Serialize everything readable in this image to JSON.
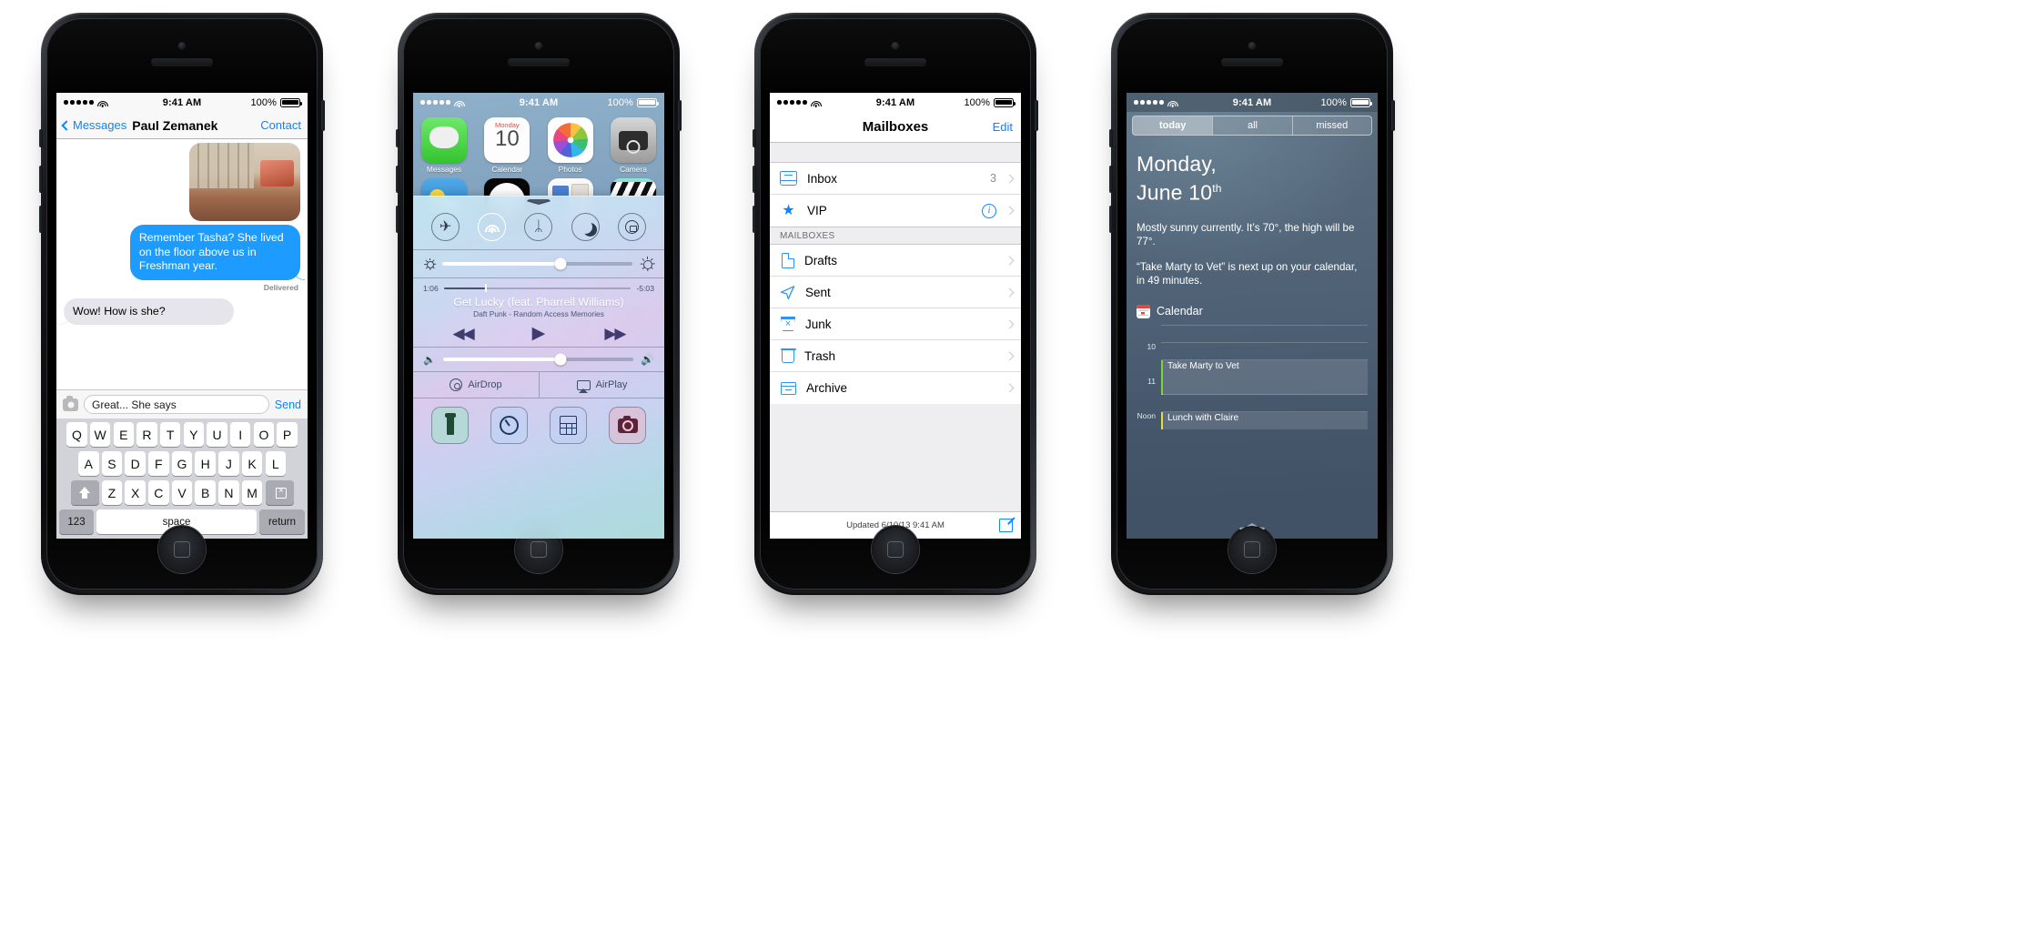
{
  "phones": {
    "messages": {
      "status": {
        "time": "9:41 AM",
        "battery": "100%",
        "signal_dots": 5
      },
      "nav": {
        "back_label": "Messages",
        "title": "Paul Zemanek",
        "right_label": "Contact"
      },
      "thread": {
        "outgoing_message": "Remember Tasha? She lived on the floor above us in Freshman year.",
        "delivered_label": "Delivered",
        "incoming_message": "Wow! How is she?"
      },
      "composer": {
        "camera_icon": "camera-icon",
        "input_value": "Great... She says",
        "send_label": "Send"
      },
      "keyboard": {
        "row1": [
          "Q",
          "W",
          "E",
          "R",
          "T",
          "Y",
          "U",
          "I",
          "O",
          "P"
        ],
        "row2": [
          "A",
          "S",
          "D",
          "F",
          "G",
          "H",
          "J",
          "K",
          "L"
        ],
        "row3": [
          "Z",
          "X",
          "C",
          "V",
          "B",
          "N",
          "M"
        ],
        "shift_icon": "shift-icon",
        "delete_icon": "delete-icon",
        "numbers_key": "123",
        "space_key": "space",
        "return_key": "return"
      }
    },
    "control_center": {
      "status": {
        "time": "9:41 AM",
        "battery": "100%",
        "signal_dots": 5
      },
      "apps_row1": [
        {
          "label": "Messages",
          "icon": "messages-app-icon"
        },
        {
          "label": "Calendar",
          "icon": "calendar-app-icon",
          "weekday": "Monday",
          "day": "10"
        },
        {
          "label": "Photos",
          "icon": "photos-app-icon"
        },
        {
          "label": "Camera",
          "icon": "camera-app-icon"
        }
      ],
      "apps_row2": [
        {
          "label": "",
          "icon": "weather-app-icon"
        },
        {
          "label": "",
          "icon": "clock-app-icon"
        },
        {
          "label": "",
          "icon": "newsstand-app-icon"
        },
        {
          "label": "",
          "icon": "videos-app-icon"
        }
      ],
      "toggles": [
        {
          "name": "airplane-mode-toggle",
          "glyph": "✈",
          "on": false
        },
        {
          "name": "wifi-toggle",
          "glyph": "wifi-icon",
          "on": true
        },
        {
          "name": "bluetooth-toggle",
          "glyph": "ᛦ",
          "on": false
        },
        {
          "name": "do-not-disturb-toggle",
          "glyph": "moon-icon",
          "on": false
        },
        {
          "name": "rotation-lock-toggle",
          "glyph": "lock-icon",
          "on": false
        }
      ],
      "brightness": {
        "value_percent": 62
      },
      "music": {
        "elapsed": "1:06",
        "remaining": "-5:03",
        "progress_percent": 22,
        "track": "Get Lucky (feat. Pharrell Williams)",
        "artist_album": "Daft Punk - Random Access Memories",
        "rewind_glyph": "◀◀",
        "play_glyph": "▶",
        "forward_glyph": "▶▶"
      },
      "volume": {
        "value_percent": 62
      },
      "air": [
        {
          "label": "AirDrop",
          "icon": "airdrop-icon"
        },
        {
          "label": "AirPlay",
          "icon": "airplay-icon"
        }
      ],
      "shortcuts": [
        {
          "name": "flashlight-shortcut",
          "icon": "flashlight-icon"
        },
        {
          "name": "timer-shortcut",
          "icon": "timer-icon"
        },
        {
          "name": "calculator-shortcut",
          "icon": "calculator-icon"
        },
        {
          "name": "camera-shortcut",
          "icon": "camera-icon"
        }
      ]
    },
    "mail": {
      "status": {
        "time": "9:41 AM",
        "battery": "100%",
        "signal_dots": 5
      },
      "nav": {
        "title": "Mailboxes",
        "edit_label": "Edit"
      },
      "top_rows": [
        {
          "label": "Inbox",
          "icon": "inbox-icon",
          "count": "3",
          "has_info": false
        },
        {
          "label": "VIP",
          "icon": "star-icon",
          "count": "",
          "has_info": true
        }
      ],
      "section_header": "MAILBOXES",
      "mailboxes": [
        {
          "label": "Drafts",
          "icon": "drafts-icon"
        },
        {
          "label": "Sent",
          "icon": "sent-icon"
        },
        {
          "label": "Junk",
          "icon": "junk-icon"
        },
        {
          "label": "Trash",
          "icon": "trash-icon"
        },
        {
          "label": "Archive",
          "icon": "archive-icon"
        }
      ],
      "toolbar": {
        "updated": "Updated 6/10/13 9:41 AM",
        "compose_icon": "compose-icon"
      }
    },
    "notification_center": {
      "status": {
        "time": "9:41 AM",
        "battery": "100%",
        "signal_dots": 5
      },
      "segments": [
        {
          "label": "today",
          "active": true
        },
        {
          "label": "all",
          "active": false
        },
        {
          "label": "missed",
          "active": false
        }
      ],
      "date_line1": "Monday,",
      "date_day": "June 10",
      "date_suffix": "th",
      "summary_weather": "Mostly sunny currently. It’s 70°, the high will be 77°.",
      "summary_calendar": "“Take Marty to Vet” is next up on your calendar, in 49 minutes.",
      "calendar_header": {
        "label": "Calendar",
        "icon": "calendar-icon"
      },
      "schedule": [
        {
          "time": "",
          "event": ""
        },
        {
          "time": "10",
          "event": ""
        },
        {
          "time": "",
          "event": "Take Marty to Vet",
          "color": "#7bd43c"
        },
        {
          "time": "11",
          "event": ""
        },
        {
          "time": "",
          "event": ""
        },
        {
          "time": "Noon",
          "event": "Lunch with Claire",
          "color": "#e9dc3a"
        }
      ],
      "grabber_icon": "grabber-icon"
    }
  },
  "colors": {
    "ios_blue": "#0b84ff",
    "bubble_blue": "#1e9bff",
    "bubble_gray": "#e6e5eb"
  }
}
